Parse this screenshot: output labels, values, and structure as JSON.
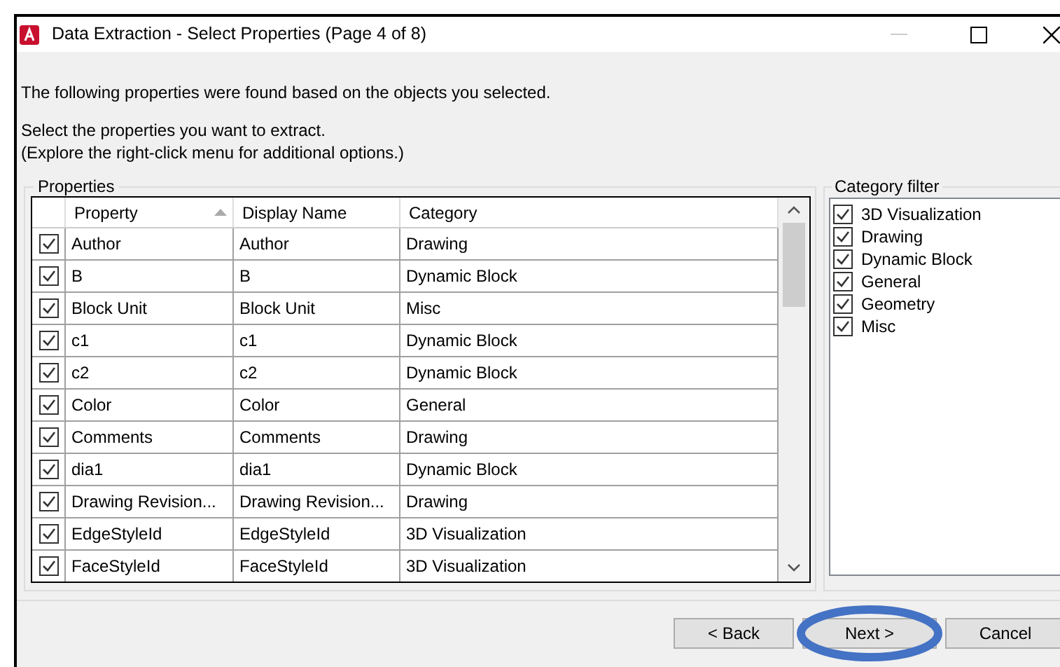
{
  "window": {
    "title": "Data Extraction - Select Properties (Page 4 of 8)"
  },
  "intro": "The following properties were found based on the objects you selected.",
  "instructions": [
    "Select the properties you want to extract.",
    "(Explore the right-click menu for additional options.)"
  ],
  "properties": {
    "title": "Properties",
    "columns": [
      {
        "label": "Property",
        "sorted": true
      },
      {
        "label": "Display Name",
        "sorted": false
      },
      {
        "label": "Category",
        "sorted": false
      }
    ],
    "rows": [
      {
        "checked": true,
        "property": "Author",
        "display_name": "Author",
        "category": "Drawing"
      },
      {
        "checked": true,
        "property": "B",
        "display_name": "B",
        "category": "Dynamic Block"
      },
      {
        "checked": true,
        "property": "Block Unit",
        "display_name": "Block Unit",
        "category": "Misc"
      },
      {
        "checked": true,
        "property": "c1",
        "display_name": "c1",
        "category": "Dynamic Block"
      },
      {
        "checked": true,
        "property": "c2",
        "display_name": "c2",
        "category": "Dynamic Block"
      },
      {
        "checked": true,
        "property": "Color",
        "display_name": "Color",
        "category": "General"
      },
      {
        "checked": true,
        "property": "Comments",
        "display_name": "Comments",
        "category": "Drawing"
      },
      {
        "checked": true,
        "property": "dia1",
        "display_name": "dia1",
        "category": "Dynamic Block"
      },
      {
        "checked": true,
        "property": "Drawing Revision...",
        "display_name": "Drawing Revision...",
        "category": "Drawing"
      },
      {
        "checked": true,
        "property": "EdgeStyleId",
        "display_name": "EdgeStyleId",
        "category": "3D Visualization"
      },
      {
        "checked": true,
        "property": "FaceStyleId",
        "display_name": "FaceStyleId",
        "category": "3D Visualization"
      }
    ]
  },
  "category_filter": {
    "title": "Category filter",
    "items": [
      {
        "label": "3D Visualization",
        "checked": true
      },
      {
        "label": "Drawing",
        "checked": true
      },
      {
        "label": "Dynamic Block",
        "checked": true
      },
      {
        "label": "General",
        "checked": true
      },
      {
        "label": "Geometry",
        "checked": true
      },
      {
        "label": "Misc",
        "checked": true
      }
    ]
  },
  "buttons": [
    {
      "label": "< Back",
      "circled": false
    },
    {
      "label": "Next >",
      "circled": true
    },
    {
      "label": "Cancel",
      "circled": false
    }
  ]
}
